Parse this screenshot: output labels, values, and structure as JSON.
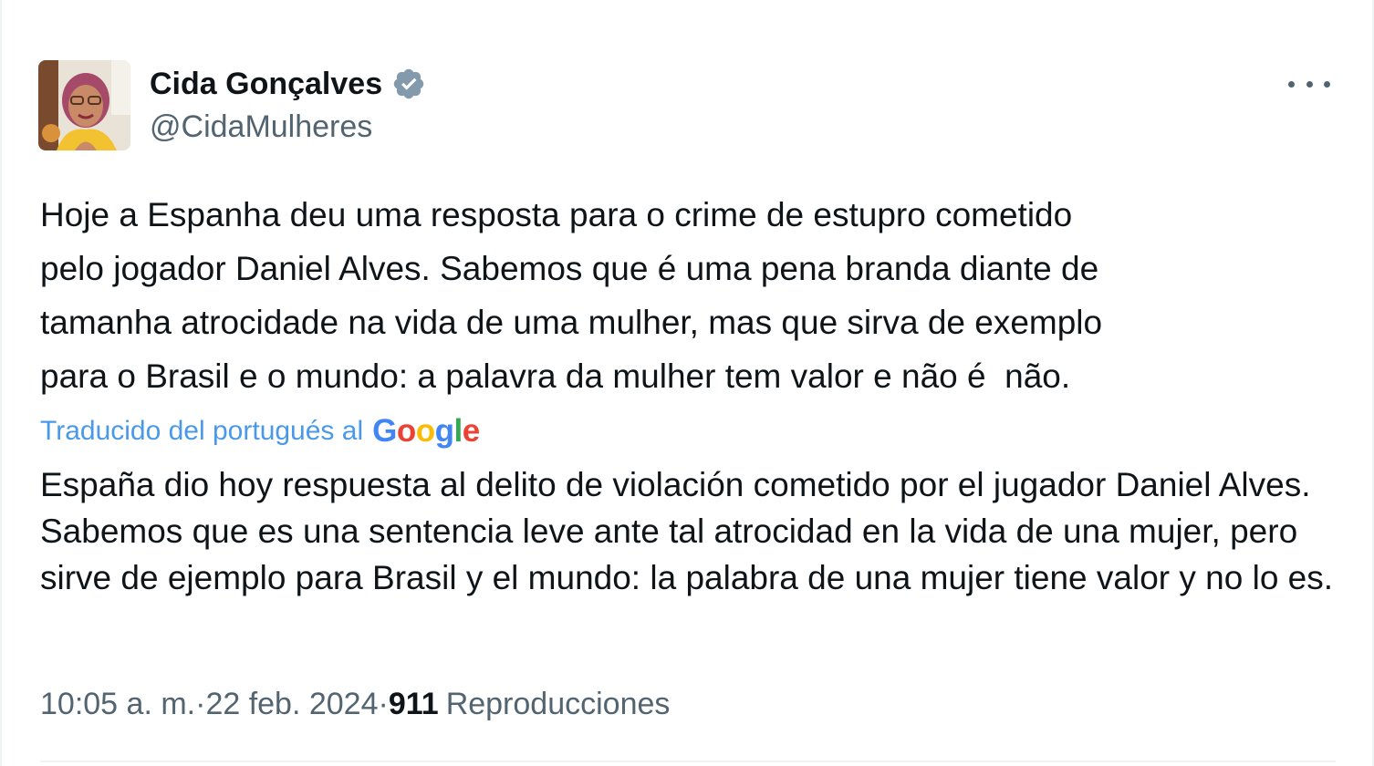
{
  "author": {
    "display_name": "Cida Gonçalves",
    "handle": "@CidaMulheres",
    "verified_icon": "verified-badge-icon",
    "badge_color": "#829aab"
  },
  "menu": {
    "icon": "more-horizontal-icon"
  },
  "tweet": {
    "original_text": "Hoje a Espanha deu uma resposta para o crime de estupro cometido\npelo jogador Daniel Alves. Sabemos que é uma pena branda diante de\ntamanha atrocidade na vida de uma mulher, mas que sirva de exemplo\npara o Brasil e o mundo: a palavra da mulher tem valor e não é  não.",
    "translation_label": "Traducido del portugués al",
    "translation_provider": "Google",
    "translated_text": "España dio hoy respuesta al delito de violación cometido por el jugador Daniel Alves. Sabemos que es una sentencia leve ante tal atrocidad en la vida de una mujer, pero sirve de ejemplo para Brasil y el mundo: la palabra de una mujer tiene valor y no lo es."
  },
  "meta": {
    "time": "10:05 a. m.",
    "separator": " · ",
    "date": "22 feb. 2024",
    "views_count": "911",
    "views_label": "Reproducciones"
  },
  "colors": {
    "link": "#4a99e9",
    "secondary_text": "#536471",
    "primary_text": "#0f1419"
  }
}
